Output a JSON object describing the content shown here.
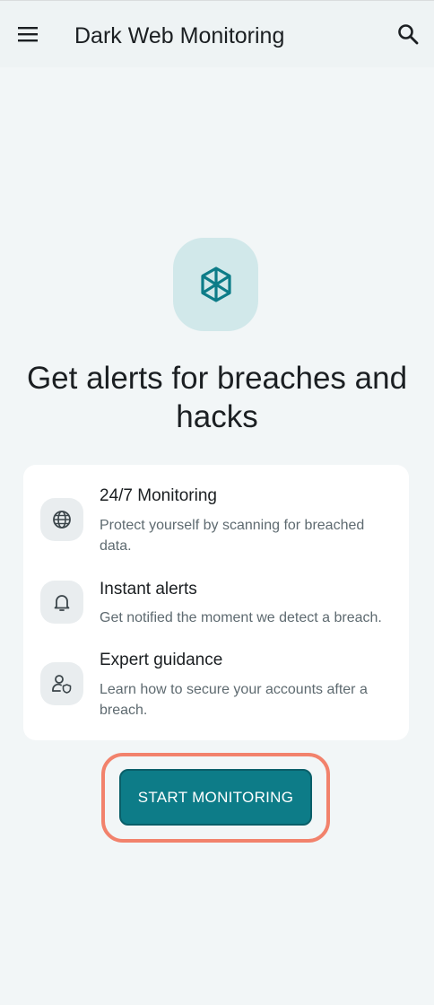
{
  "header": {
    "title": "Dark Web Monitoring",
    "menu_icon": "hamburger-menu-icon",
    "search_icon": "search-icon"
  },
  "hero": {
    "icon": "cube-shield-icon",
    "headline": "Get alerts for breaches and hacks"
  },
  "features": [
    {
      "icon": "globe-icon",
      "title": "24/7 Monitoring",
      "description": "Protect yourself by scanning for breached data."
    },
    {
      "icon": "bell-icon",
      "title": "Instant alerts",
      "description": "Get notified the moment we detect a breach."
    },
    {
      "icon": "user-shield-icon",
      "title": "Expert guidance",
      "description": "Learn how to secure your accounts after a breach."
    }
  ],
  "cta": {
    "label": "START MONITORING"
  },
  "colors": {
    "background": "#f2f6f7",
    "header_background": "#eef3f4",
    "accent": "#0d7c88",
    "hero_icon_background": "#d1e8ea",
    "highlight": "#f2826c"
  }
}
